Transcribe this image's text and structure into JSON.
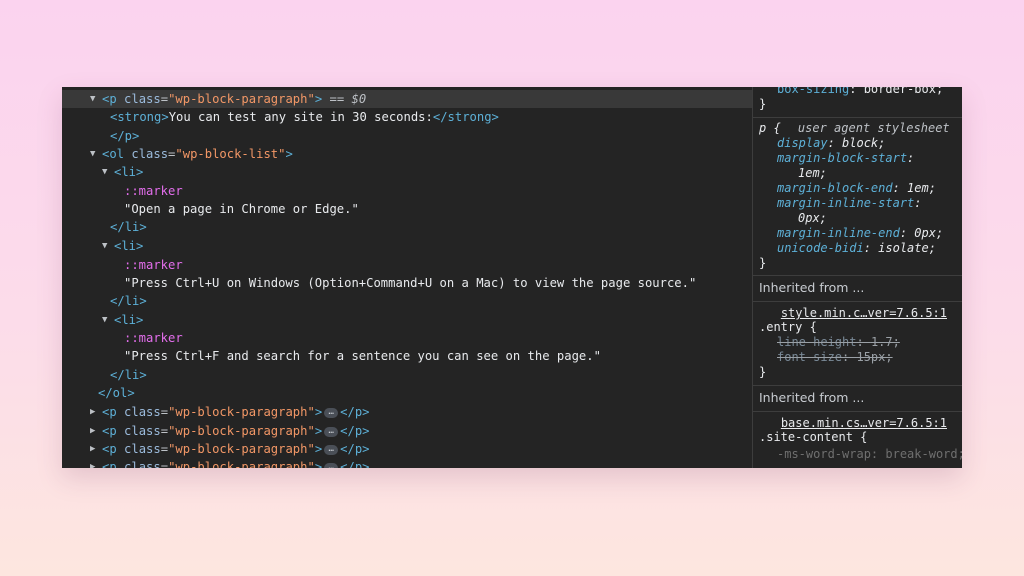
{
  "elements": {
    "selected_p": {
      "tag_open": "<p",
      "attr_name": "class",
      "attr_value": "\"wp-block-paragraph\"",
      "tag_close": ">",
      "eq": "==",
      "ref": "$0"
    },
    "strong": {
      "open": "<strong>",
      "text": "You can test any site in 30 seconds:",
      "close": "</strong>"
    },
    "p_close": "</p>",
    "ol_open": {
      "tag_open": "<ol",
      "attr_name": "class",
      "attr_value": "\"wp-block-list\"",
      "tag_close": ">"
    },
    "li_open": "<li>",
    "marker": "::marker",
    "li_close": "</li>",
    "items": [
      {
        "text": "\"Open a page in Chrome or Edge.\""
      },
      {
        "text": "\"Press Ctrl+U on Windows (Option+Command+U on a Mac) to view the page source.\""
      },
      {
        "text": "\"Press Ctrl+F and search for a sentence you can see on the page.\""
      }
    ],
    "ol_close": "</ol>",
    "collapsed_p": {
      "tag_open": "<p",
      "attr_name": "class",
      "attr_value": "\"wp-block-paragraph\"",
      "tag_close": ">",
      "ellipsis": "…",
      "close": "</p>"
    }
  },
  "styles": {
    "top_partial": {
      "prop": "box-sizing",
      "value": "border-box;"
    },
    "close_brace": "}",
    "ua_rule": {
      "selector": "p {",
      "source": "user agent stylesheet",
      "props": [
        {
          "name": "display",
          "value": "block;"
        },
        {
          "name": "margin-block-start",
          "value": "1em;"
        },
        {
          "name": "margin-block-end",
          "value": "1em;"
        },
        {
          "name": "margin-inline-start",
          "value": "0px;"
        },
        {
          "name": "margin-inline-end",
          "value": "0px;"
        },
        {
          "name": "unicode-bidi",
          "value": "isolate;"
        }
      ]
    },
    "inherited_label": "Inherited from ...",
    "entry_rule": {
      "source": "style.min.c…ver=7.6.5:1",
      "selector": ".entry {",
      "props": [
        {
          "name": "line-height",
          "value": "1.7;"
        },
        {
          "name": "font-size",
          "value": "15px;"
        }
      ]
    },
    "site_rule": {
      "source": "base.min.cs…ver=7.6.5:1",
      "selector": ".site-content {",
      "props": [
        {
          "name": "-ms-word-wrap",
          "value": "break-word;"
        }
      ]
    }
  }
}
